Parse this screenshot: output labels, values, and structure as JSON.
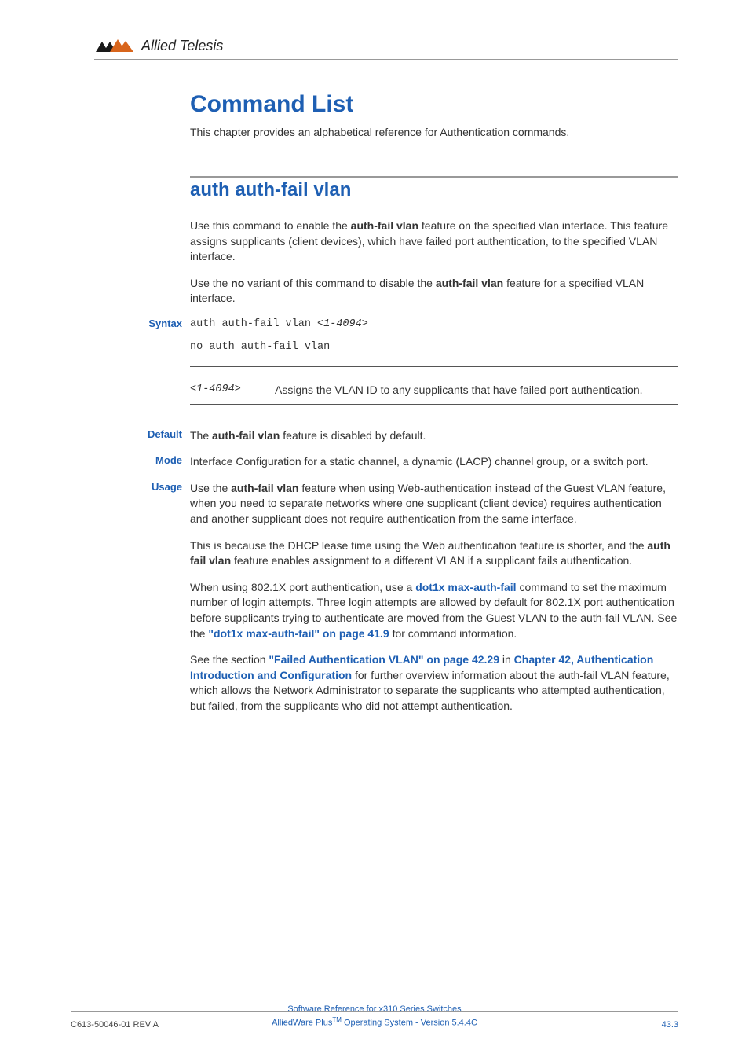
{
  "brand": {
    "name": "Allied Telesis"
  },
  "section": {
    "title": "Command List",
    "intro": "This chapter provides an alphabetical reference for Authentication commands."
  },
  "command": {
    "title": "auth auth-fail vlan",
    "para1_a": "Use this command to enable the ",
    "para1_b": "auth-fail vlan",
    "para1_c": " feature on the specified vlan interface. This feature assigns supplicants (client devices), which have failed port authentication, to the specified VLAN interface.",
    "para2_a": "Use the ",
    "para2_b": "no",
    "para2_c": " variant of this command to disable the ",
    "para2_d": "auth-fail vlan",
    "para2_e": " feature for a specified VLAN interface."
  },
  "syntax": {
    "label": "Syntax",
    "line1_a": "auth auth-fail vlan ",
    "line1_b": "<1-4094>",
    "line2": "no auth auth-fail vlan"
  },
  "param": {
    "key": "<1-4094>",
    "desc": "Assigns the VLAN ID to any supplicants that have failed port authentication."
  },
  "default": {
    "label": "Default",
    "text_a": "The ",
    "text_b": "auth-fail vlan",
    "text_c": " feature is disabled by default."
  },
  "mode": {
    "label": "Mode",
    "text": "Interface Configuration for a static channel, a dynamic (LACP) channel group, or a switch port."
  },
  "usage": {
    "label": "Usage",
    "p1_a": "Use the ",
    "p1_b": "auth-fail vlan",
    "p1_c": " feature when using Web-authentication instead of the Guest VLAN feature, when you need to separate networks where one supplicant (client device) requires authentication and another supplicant does not require authentication from the same interface.",
    "p2_a": "This is because the DHCP lease time using the Web authentication feature is shorter, and the ",
    "p2_b": "auth fail vlan",
    "p2_c": " feature enables assignment to a different VLAN if a supplicant fails authentication.",
    "p3_a": "When using 802.1X port authentication, use a ",
    "p3_link1": "dot1x max-auth-fail",
    "p3_b": " command to set the maximum number of login attempts. Three login attempts are allowed by default for 802.1X port authentication before supplicants trying to authenticate are moved from the Guest VLAN to the auth-fail VLAN. See the ",
    "p3_link2": "\"dot1x max-auth-fail\" on page 41.9",
    "p3_c": " for command information.",
    "p4_a": "See the section ",
    "p4_link1": "\"Failed Authentication VLAN\" on page 42.29",
    "p4_b": " in ",
    "p4_link2": "Chapter 42, Authentication Introduction and Configuration",
    "p4_c": " for further overview information about the auth-fail VLAN feature, which allows the Network Administrator to separate the supplicants who attempted authentication, but failed, from the supplicants who did not attempt authentication."
  },
  "footer": {
    "left": "C613-50046-01 REV A",
    "center1": "Software Reference for x310 Series Switches",
    "center2_a": "AlliedWare Plus",
    "center2_tm": "TM",
    "center2_b": " Operating System - Version 5.4.4C",
    "right": "43.3"
  }
}
